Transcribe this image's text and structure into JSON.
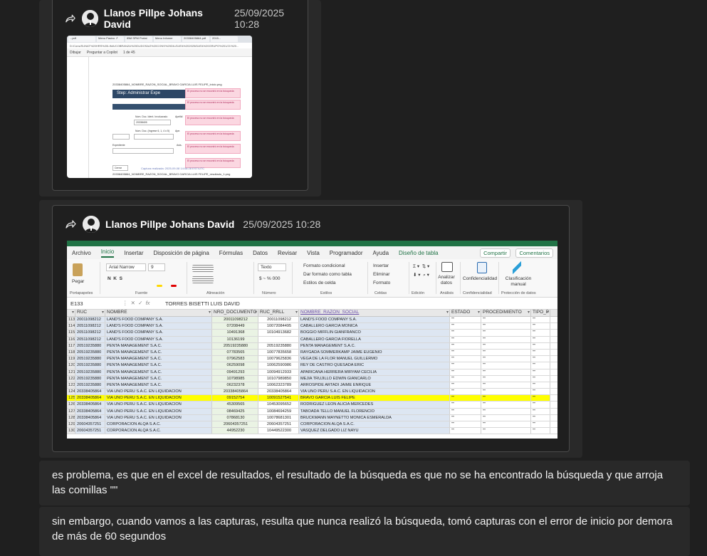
{
  "messages": [
    {
      "sender": "Llanos Pillpe Johans David",
      "timestamp": "25/09/2025 10:28",
      "type": "forwarded-image",
      "image": {
        "tabs": [
          "...pdf",
          "Menu Pasivo ↗",
          "IBM SPM Portal",
          "Menu Infomer",
          "20338405864.pdf",
          "2015..."
        ],
        "url": "D:/Cons/SUNAT%20HRS%20LIMA/COBRANZA%20DUDOSA/2%20CONS%20DIL/DATA%202025/DATA%20GRUPO%201/21%20...",
        "toolbar": [
          "Dibujar",
          "Preguntar a Copilot",
          "1 de 45"
        ],
        "top_caption": "20338405864_NOMBRE_RAZON_SOCIAL_BRAVO GARCIA LUIS FELIPE_inicio.png",
        "banner": "Step: Administrar Expe",
        "errors": [
          "El proceso no se encontró en la búsqueda",
          "El proceso no se encontró en la búsqueda",
          "El proceso no se encontró en la búsqueda",
          "El proceso no se encontró en la búsqueda",
          "El proceso no se encontró en la búsqueda",
          "El proceso no se encontró en la búsqueda"
        ],
        "labels": [
          "Nom. Doc. Ident. Involucrado",
          "Apellid",
          "Num. Doc. (Ingrese 6, 1, 4 ó 5)",
          "Ape.",
          "Expediente",
          "Asis."
        ],
        "field_value": "20338405",
        "footer_left": "Cerrar",
        "footer_capture": "Captura realizada: 2025-09-08 14:08:28 EST/UTC",
        "bottom_caption": "20338405864_NOMBRE_RAZON_SOCIAL_BRAVO GARCIA LUIS FELIPE_resultado_1.png"
      }
    },
    {
      "sender": "Llanos Pillpe Johans David",
      "timestamp": "25/09/2025 10:28",
      "type": "forwarded-image",
      "excel": {
        "menu": [
          "Archivo",
          "Inicio",
          "Insertar",
          "Disposición de página",
          "Fórmulas",
          "Datos",
          "Revisar",
          "Vista",
          "Programador",
          "Ayuda",
          "Diseño de tabla"
        ],
        "share": "Compartir",
        "comments": "Comentarios",
        "ribbon": {
          "paste": "Pegar",
          "font": "Arial Narrow",
          "font_size": "9",
          "number_format": "Texto",
          "conditional": "Formato condicional",
          "as_table": "Dar formato como tabla",
          "cell_styles": "Estilos de celda",
          "insert": "Insertar",
          "delete": "Eliminar",
          "format": "Formato",
          "analyze": "Analizar datos",
          "confidentiality": "Confidencialidad",
          "classification": "Clasificación manual",
          "groups": [
            "Portapapeles",
            "Fuente",
            "Alineación",
            "Número",
            "Estilos",
            "Celdas",
            "Edición",
            "Análisis",
            "Confidencialidad",
            "Protección de datos"
          ]
        },
        "cell_ref": "E133",
        "formula": "TORRES BISETTI LUIS DAVID",
        "headers": [
          "RUC",
          "NOMBRE",
          "NRO_DOCUMENTO",
          "RUC_RRLL",
          "NOMBRE_RAZON_SOCIAL",
          "ESTADO",
          "PROCEDIMIENTO",
          "TIPO_P"
        ],
        "rows": [
          {
            "n": "113",
            "ruc": "20011098212",
            "nombre": "LAND'S FOOD COMPANY S.A.",
            "doc": "20011098212",
            "rrll": "20011098212",
            "razon": "LAND'S FOOD COMPANY S.A.",
            "estado": "\"\"",
            "proc": "\"\"",
            "tipo": "\"\""
          },
          {
            "n": "114",
            "ruc": "20511098212",
            "nombre": "LAND'S FOOD COMPANY S.A.",
            "doc": "07208449",
            "rrll": "10072084495",
            "razon": "CABALLERO GARCIA MONICA",
            "estado": "\"\"",
            "proc": "\"\"",
            "tipo": "\"\""
          },
          {
            "n": "115",
            "ruc": "20511098212",
            "nombre": "LAND'S FOOD COMPANY S.A.",
            "doc": "10491368",
            "rrll": "10104913682",
            "razon": "BOGGIO MIFFLIN GIANFRANCO",
            "estado": "\"\"",
            "proc": "\"\"",
            "tipo": "\"\""
          },
          {
            "n": "116",
            "ruc": "20511098212",
            "nombre": "LAND'S FOOD COMPANY S.A.",
            "doc": "10136199",
            "rrll": "",
            "razon": "CABALLERO GARCIA FIORELLA",
            "estado": "\"\"",
            "proc": "\"\"",
            "tipo": "\"\""
          },
          {
            "n": "117",
            "ruc": "20519235880",
            "nombre": "PENTA MANAGEMENT S.A.C.",
            "doc": "20519235880",
            "rrll": "20519235880",
            "razon": "PENTA MANAGEMENT S.A.C.",
            "estado": "\"\"",
            "proc": "\"\"",
            "tipo": "\"\""
          },
          {
            "n": "118",
            "ruc": "20519235880",
            "nombre": "PENTA MANAGEMENT S.A.C.",
            "doc": "07783565",
            "rrll": "10077835658",
            "razon": "RAYGADA SOMMERKAMP JAIME EUGENIO",
            "estado": "\"\"",
            "proc": "\"\"",
            "tipo": "\"\""
          },
          {
            "n": "119",
            "ruc": "20519235880",
            "nombre": "PENTA MANAGEMENT S.A.C.",
            "doc": "07962583",
            "rrll": "10079625836",
            "razon": "VEGA DE LA FLOR MANUEL GUILLERMO",
            "estado": "\"\"",
            "proc": "\"\"",
            "tipo": "\"\""
          },
          {
            "n": "120",
            "ruc": "20519235880",
            "nombre": "PENTA MANAGEMENT S.A.C.",
            "doc": "06259098",
            "rrll": "10062590986",
            "razon": "REY DE CASTRO QUESADA ERIC",
            "estado": "\"\"",
            "proc": "\"\"",
            "tipo": "\"\""
          },
          {
            "n": "121",
            "ruc": "20519235880",
            "nombre": "PENTA MANAGEMENT S.A.C.",
            "doc": "09491293",
            "rrll": "10094912933",
            "razon": "APARICANA HERRERA MIRYAM CECILIA",
            "estado": "\"\"",
            "proc": "\"\"",
            "tipo": "\"\""
          },
          {
            "n": "122",
            "ruc": "20519235880",
            "nombre": "PENTA MANAGEMENT S.A.C.",
            "doc": "10798985",
            "rrll": "10107989850",
            "razon": "MEJIA TRUJILLO EDWIN GIANCARLO",
            "estado": "\"\"",
            "proc": "\"\"",
            "tipo": "\"\""
          },
          {
            "n": "123",
            "ruc": "20519235880",
            "nombre": "PENTA MANAGEMENT S.A.C.",
            "doc": "06232378",
            "rrll": "10062323789",
            "razon": "ARROSPIDE ARTADI JAIME ENRIQUE",
            "estado": "\"\"",
            "proc": "\"\"",
            "tipo": "\"\""
          },
          {
            "n": "124",
            "ruc": "20338405864",
            "nombre": "VIA UNO PERU S.A.C. EN LIQUIDACION",
            "doc": "20338405864",
            "rrll": "20338405864",
            "razon": "VIA UNO PERU S.A.C. EN LIQUIDACION",
            "estado": "\"\"",
            "proc": "\"\"",
            "tipo": "\"\""
          },
          {
            "n": "125",
            "ruc": "20338405864",
            "nombre": "VIA UNO PERU S.A.C. EN LIQUIDACION",
            "doc": "09152754",
            "rrll": "10091527541",
            "razon": "BRAVO GARCIA LUIS FELIPE",
            "estado": "\"\"",
            "proc": "\"\"",
            "tipo": "\"\"",
            "highlight": true
          },
          {
            "n": "126",
            "ruc": "20338405864",
            "nombre": "VIA UNO PERU S.A.C. EN LIQUIDACION",
            "doc": "45309565",
            "rrll": "10453095652",
            "razon": "RODRIGUEZ LEON ALICIA MERCEDES",
            "estado": "\"\"",
            "proc": "\"\"",
            "tipo": "\"\""
          },
          {
            "n": "127",
            "ruc": "20338405864",
            "nombre": "VIA UNO PERU S.A.C. EN LIQUIDACION",
            "doc": "08469425",
            "rrll": "10084694259",
            "razon": "TABOADA TELLO MANUEL FLORENCIO",
            "estado": "\"\"",
            "proc": "\"\"",
            "tipo": "\"\""
          },
          {
            "n": "128",
            "ruc": "20338405864",
            "nombre": "VIA UNO PERU S.A.C. EN LIQUIDACION",
            "doc": "07868130",
            "rrll": "10078681301",
            "razon": "BRUCKMANN MAYNETTO MONICA ESMERALDA",
            "estado": "\"\"",
            "proc": "\"\"",
            "tipo": "\"\""
          },
          {
            "n": "129",
            "ruc": "20604357251",
            "nombre": "CORPORACION ALQA S.A.C.",
            "doc": "20604357251",
            "rrll": "20604357251",
            "razon": "CORPORACION ALQA S.A.C.",
            "estado": "\"\"",
            "proc": "\"\"",
            "tipo": "\"\""
          },
          {
            "n": "130",
            "ruc": "20604357251",
            "nombre": "CORPORACION ALQA S.A.C.",
            "doc": "44952230",
            "rrll": "10449522300",
            "razon": "VASQUEZ DELGADO LIZ NAYU",
            "estado": "\"\"",
            "proc": "\"\"",
            "tipo": "\"\""
          }
        ]
      }
    },
    {
      "type": "text",
      "text": "es problema, es que en el excel de resultados, el resultado de la búsqueda es que no se ha encontrado la búsqueda y que arroja las comillas \"\""
    },
    {
      "type": "text",
      "text": "sin embargo, cuando vamos a las capturas, resulta que nunca realizó la búsqueda, tomó capturas con el error de inicio por demora de más de 60 segundos"
    }
  ]
}
